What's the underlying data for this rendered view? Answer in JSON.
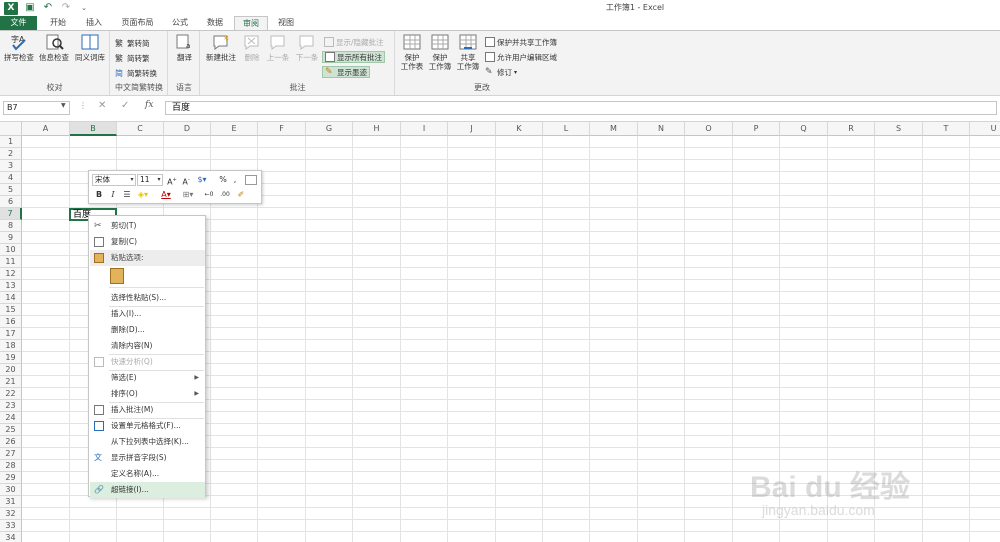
{
  "window": {
    "title": "工作簿1 - Excel"
  },
  "tabs": [
    "文件",
    "开始",
    "插入",
    "页面布局",
    "公式",
    "数据",
    "审阅",
    "视图"
  ],
  "active_tab": "审阅",
  "ribbon": {
    "proofing": {
      "label": "校对",
      "spell": "拼写检查",
      "research": "信息检查",
      "thesaurus": "同义词库"
    },
    "chinese": {
      "label": "中文简繁转换",
      "to_trad": "繁转简",
      "to_simp": "简转繁",
      "convert": "简繁转换"
    },
    "language": {
      "label": "语言",
      "translate": "翻译"
    },
    "comments": {
      "label": "批注",
      "new": "新建批注",
      "delete": "删除",
      "prev": "上一条",
      "next": "下一条",
      "show_hide": "显示/隐藏批注",
      "show_all": "显示所有批注",
      "show_ink": "显示墨迹"
    },
    "changes": {
      "label": "更改",
      "protect_sheet_1": "保护",
      "protect_sheet_2": "工作表",
      "protect_book_1": "保护",
      "protect_book_2": "工作簿",
      "share_1": "共享",
      "share_2": "工作簿",
      "protect_share": "保护并共享工作簿",
      "allow_edit": "允许用户编辑区域",
      "track": "修订"
    }
  },
  "formula_bar": {
    "name_box": "B7",
    "fx": "fx",
    "content": "百度"
  },
  "columns": [
    "A",
    "B",
    "C",
    "D",
    "E",
    "F",
    "G",
    "H",
    "I",
    "J",
    "K",
    "L",
    "M",
    "N",
    "O",
    "P",
    "Q",
    "R",
    "S",
    "T",
    "U"
  ],
  "rows": [
    "1",
    "2",
    "3",
    "4",
    "5",
    "6",
    "7",
    "8",
    "9",
    "10",
    "11",
    "12",
    "13",
    "14",
    "15",
    "16",
    "17",
    "18",
    "19",
    "20",
    "21",
    "22",
    "23",
    "24",
    "25",
    "26",
    "27",
    "28",
    "29",
    "30",
    "31",
    "32",
    "33",
    "34"
  ],
  "active_cell": {
    "ref": "B7",
    "value": "百度"
  },
  "mini_toolbar": {
    "font": "宋体",
    "size": "11",
    "percent": "%"
  },
  "context_menu": [
    {
      "label": "剪切(T)",
      "icon": "scissors-icon"
    },
    {
      "label": "复制(C)",
      "icon": "copy-icon"
    },
    {
      "label": "粘贴选项:",
      "icon": "paste-icon"
    },
    {
      "label": "选择性粘贴(S)...",
      "icon": ""
    },
    {
      "label": "插入(I)...",
      "icon": ""
    },
    {
      "label": "删除(D)...",
      "icon": ""
    },
    {
      "label": "清除内容(N)",
      "icon": ""
    },
    {
      "label": "快速分析(Q)",
      "icon": "quick-analysis-icon"
    },
    {
      "label": "筛选(E)",
      "icon": ""
    },
    {
      "label": "排序(O)",
      "icon": ""
    },
    {
      "label": "插入批注(M)",
      "icon": "comment-icon"
    },
    {
      "label": "设置单元格格式(F)...",
      "icon": "format-cells-icon"
    },
    {
      "label": "从下拉列表中选择(K)...",
      "icon": ""
    },
    {
      "label": "显示拼音字段(S)",
      "icon": "phonetic-icon"
    },
    {
      "label": "定义名称(A)...",
      "icon": ""
    },
    {
      "label": "超链接(I)...",
      "icon": "hyperlink-icon"
    }
  ],
  "watermark": {
    "logo": "Bai du 经验",
    "url": "jingyan.baidu.com"
  },
  "colors": {
    "accent": "#217346",
    "highlight": "#dceee0"
  }
}
